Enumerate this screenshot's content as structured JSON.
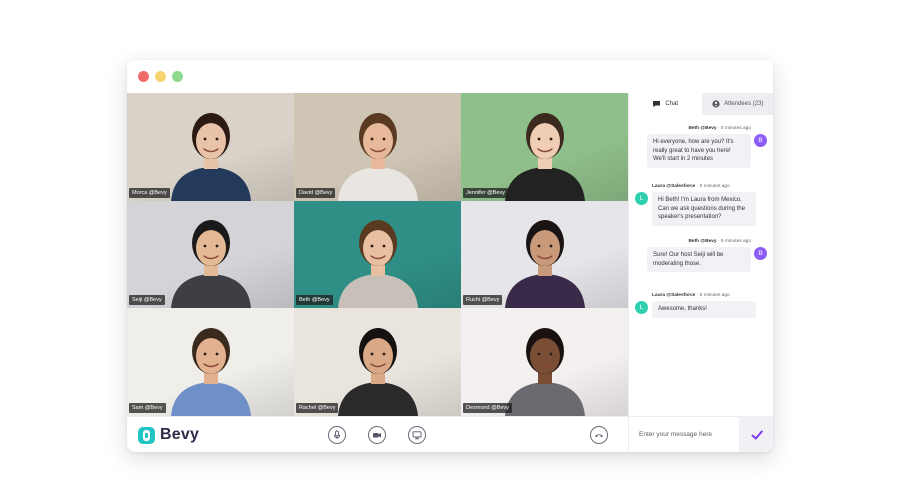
{
  "window": {
    "controls": [
      "close",
      "minimize",
      "maximize"
    ]
  },
  "participants": [
    {
      "name": "Morca @Bevy",
      "bg": "#d9d2c8",
      "shirt": "#243a5a",
      "skin": "#e8c3a8",
      "hair": "#2a1a12"
    },
    {
      "name": "David @Bevy",
      "bg": "#cfc5b5",
      "shirt": "#e9e6e2",
      "skin": "#e7b99a",
      "hair": "#5a3a22"
    },
    {
      "name": "Jennifer @Bevy",
      "bg": "#8fbf8a",
      "shirt": "#222222",
      "skin": "#f0cdb5",
      "hair": "#3c2a1f"
    },
    {
      "name": "Seiji @Bevy",
      "bg": "#d4d4d8",
      "shirt": "#3d3f45",
      "skin": "#e3b996",
      "hair": "#1a1a1a"
    },
    {
      "name": "Beth @Bevy",
      "bg": "#2f8f86",
      "shirt": "#c8c0b8",
      "skin": "#e9bfa2",
      "hair": "#5a3a20"
    },
    {
      "name": "Ruchi @Bevy",
      "bg": "#e6e6ea",
      "shirt": "#3a2a4a",
      "skin": "#c99a7a",
      "hair": "#1b1414"
    },
    {
      "name": "Sam @Bevy",
      "bg": "#f0eee9",
      "shirt": "#6e8fc8",
      "skin": "#e2b290",
      "hair": "#3a2a1e"
    },
    {
      "name": "Rachel @Bevy",
      "bg": "#e9e4dd",
      "shirt": "#2a2a2a",
      "skin": "#d8a887",
      "hair": "#151111"
    },
    {
      "name": "Desmond @Bevy",
      "bg": "#f5f0f0",
      "shirt": "#6a6a70",
      "skin": "#7a4e35",
      "hair": "#1a1210"
    }
  ],
  "brand": {
    "name": "Bevy",
    "accent": "#22c3c3"
  },
  "controls": {
    "mic": "microphone-icon",
    "camera": "camera-icon",
    "screen": "screen-share-icon",
    "hangup": "phone-hangup-icon"
  },
  "chat": {
    "tabs": [
      {
        "label": "Chat"
      },
      {
        "label": "Attendees (23)"
      }
    ],
    "messages": [
      {
        "author": "Beth @Bevy",
        "time": "· 5 minutes ago",
        "text": "Hi everyone, how are you? It's really great to have you here! We'll start in 2 minutes",
        "initial": "B",
        "color": "#8b5cf6",
        "side": "right"
      },
      {
        "author": "Laura @Salesforce",
        "time": "· 5 minutes ago",
        "text": "Hi Beth! I'm Laura from Mexico. Can we ask questions during the speaker's presentation?",
        "initial": "L",
        "color": "#2fd0b0",
        "side": "left"
      },
      {
        "author": "Beth @Bevy",
        "time": "· 5 minutes ago",
        "text": "Sure! Our host Seiji will be moderating those.",
        "initial": "B",
        "color": "#8b5cf6",
        "side": "right"
      },
      {
        "author": "Laura @Salesforce",
        "time": "· 5 minutes ago",
        "text": "Awesome, thanks!",
        "initial": "L",
        "color": "#2fd0b0",
        "side": "left"
      }
    ],
    "input_placeholder": "Enter your message here",
    "send_color": "#7c3aed"
  }
}
